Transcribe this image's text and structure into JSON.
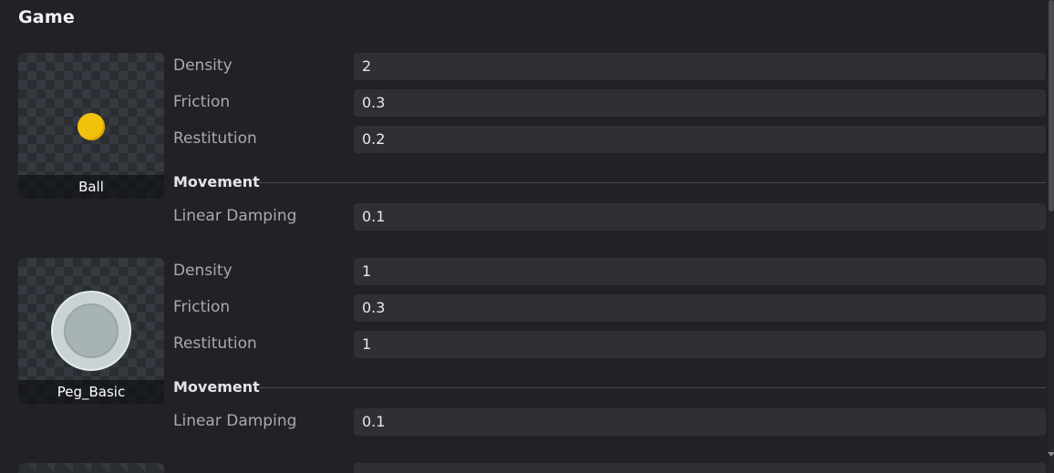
{
  "panel": {
    "title": "Game"
  },
  "items": [
    {
      "name": "Ball",
      "thumbnail_icon": "ball-sprite-icon",
      "properties": [
        {
          "label": "Density",
          "value": "2"
        },
        {
          "label": "Friction",
          "value": "0.3"
        },
        {
          "label": "Restitution",
          "value": "0.2"
        }
      ],
      "movement": {
        "heading": "Movement",
        "linear_damping_label": "Linear Damping",
        "linear_damping_value": "0.1"
      }
    },
    {
      "name": "Peg_Basic",
      "thumbnail_icon": "peg-sprite-icon",
      "properties": [
        {
          "label": "Density",
          "value": "1"
        },
        {
          "label": "Friction",
          "value": "0.3"
        },
        {
          "label": "Restitution",
          "value": "1"
        }
      ],
      "movement": {
        "heading": "Movement",
        "linear_damping_label": "Linear Damping",
        "linear_damping_value": "0.1"
      }
    }
  ],
  "colors": {
    "background": "#212127",
    "field": "#2f2f36",
    "ball": "#f2c10c",
    "peg": "#c9d3d3"
  }
}
